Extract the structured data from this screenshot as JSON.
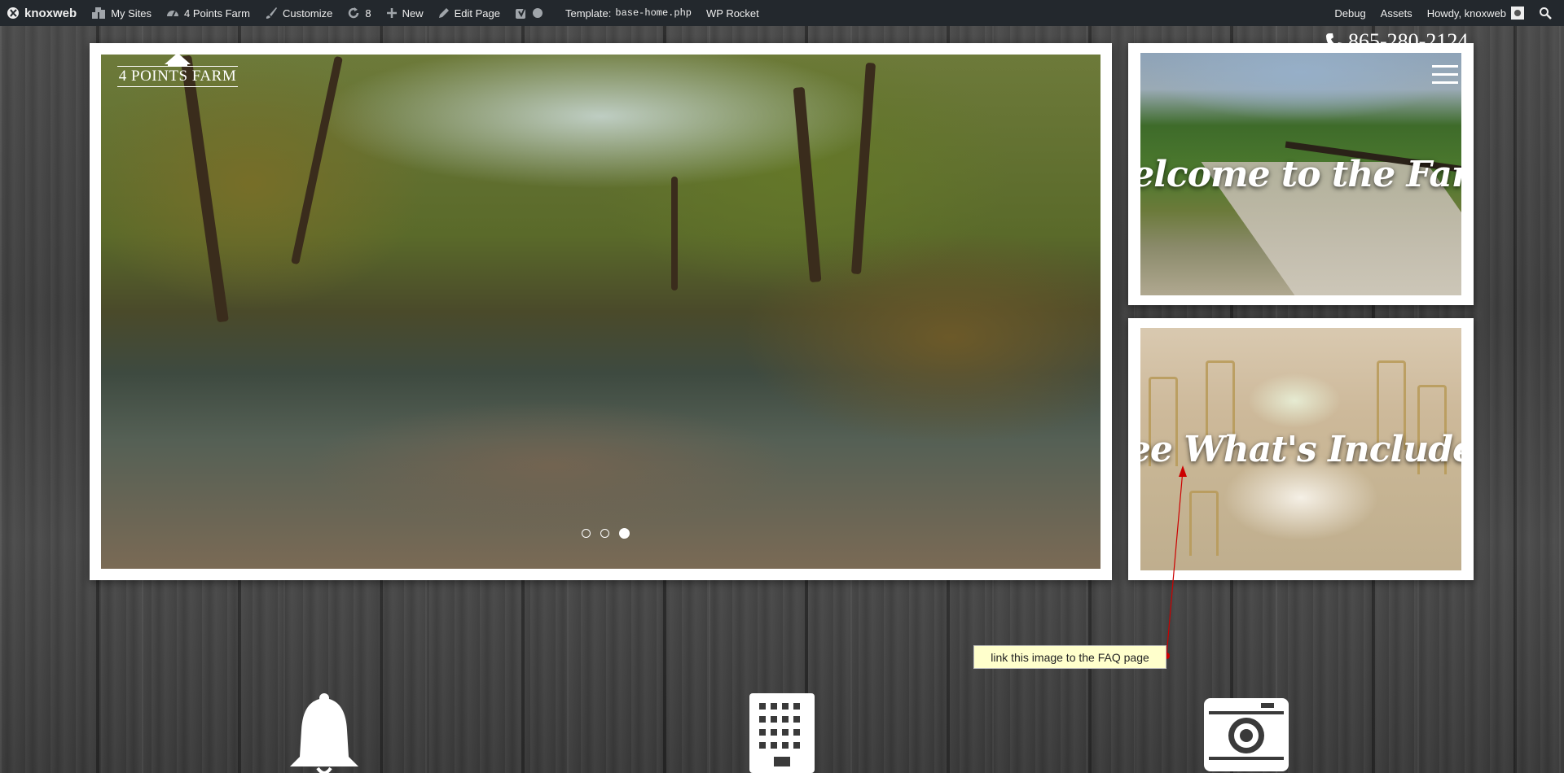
{
  "adminbar": {
    "brand": "knoxweb",
    "my_sites": "My Sites",
    "site_name": "4 Points Farm",
    "customize": "Customize",
    "updates_count": "8",
    "new": "New",
    "edit_page": "Edit Page",
    "template_label": "Template:",
    "template_file": "base-home.php",
    "wp_rocket": "WP Rocket",
    "debug": "Debug",
    "assets": "Assets",
    "howdy": "Howdy, knoxweb"
  },
  "logo": {
    "text": "4 POINTS FARM"
  },
  "phone": "865-280-2124",
  "cards": {
    "farm_title": "Welcome to the Farm",
    "included_title": "See What's Included"
  },
  "slider": {
    "count": 3,
    "active": 3
  },
  "annotation": {
    "text": "link this image to the FAQ page",
    "color": "#cc0000"
  },
  "icons": [
    "bell-icon",
    "calculator-icon",
    "camera-icon"
  ]
}
